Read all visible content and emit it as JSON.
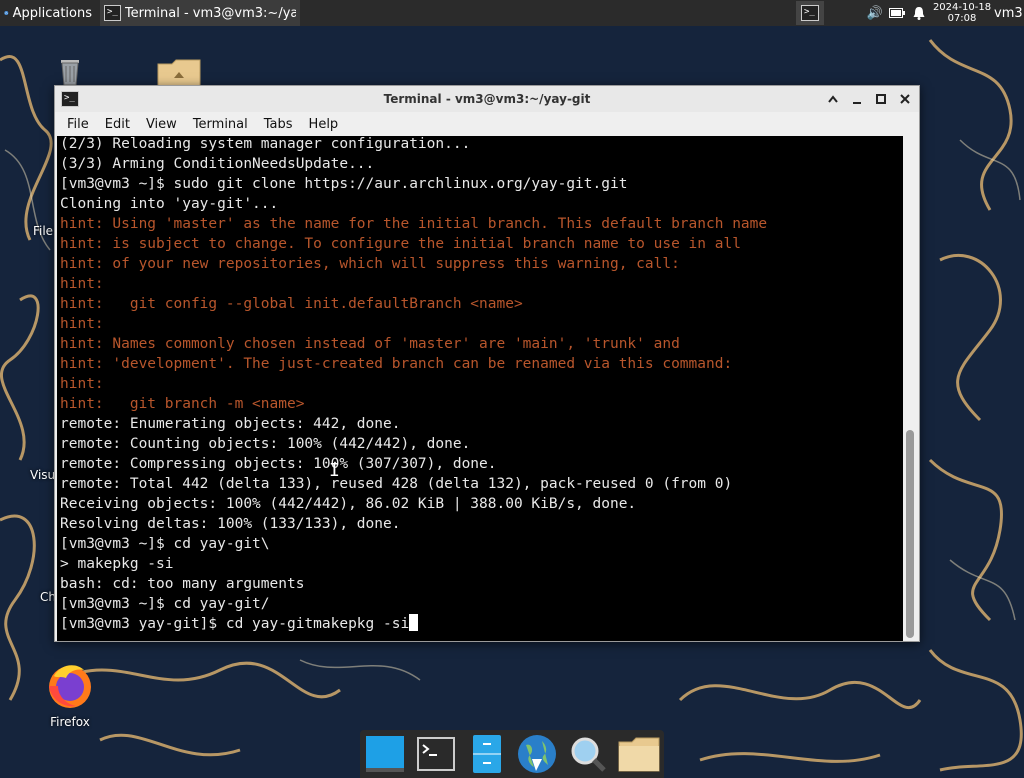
{
  "top_panel": {
    "applications_label": "Applications",
    "active_task_label": "Terminal - vm3@vm3:~/ya...",
    "clock_date": "2024-10-18",
    "clock_time": "07:08",
    "user": "vm3"
  },
  "desktop": {
    "icons": [
      {
        "name": "trash",
        "label": ""
      },
      {
        "name": "home-folder",
        "label": ""
      },
      {
        "name": "file-system",
        "label": "File"
      },
      {
        "name": "visual",
        "label": "Visu"
      },
      {
        "name": "chrome",
        "label": "Ch"
      },
      {
        "name": "firefox",
        "label": "Firefox"
      }
    ]
  },
  "window": {
    "title": "Terminal - vm3@vm3:~/yay-git",
    "menu": [
      "File",
      "Edit",
      "View",
      "Terminal",
      "Tabs",
      "Help"
    ],
    "controls": [
      "minimize-up",
      "minimize",
      "maximize",
      "close"
    ]
  },
  "terminal": {
    "lines": [
      {
        "text": "(2/3) Reloading system manager configuration...",
        "hint": false
      },
      {
        "text": "(3/3) Arming ConditionNeedsUpdate...",
        "hint": false
      },
      {
        "text": "[vm3@vm3 ~]$ sudo git clone https://aur.archlinux.org/yay-git.git",
        "hint": false
      },
      {
        "text": "Cloning into 'yay-git'...",
        "hint": false
      },
      {
        "text": "hint: Using 'master' as the name for the initial branch. This default branch name",
        "hint": true
      },
      {
        "text": "hint: is subject to change. To configure the initial branch name to use in all",
        "hint": true
      },
      {
        "text": "hint: of your new repositories, which will suppress this warning, call:",
        "hint": true
      },
      {
        "text": "hint:",
        "hint": true
      },
      {
        "text": "hint:   git config --global init.defaultBranch <name>",
        "hint": true
      },
      {
        "text": "hint:",
        "hint": true
      },
      {
        "text": "hint: Names commonly chosen instead of 'master' are 'main', 'trunk' and",
        "hint": true
      },
      {
        "text": "hint: 'development'. The just-created branch can be renamed via this command:",
        "hint": true
      },
      {
        "text": "hint:",
        "hint": true
      },
      {
        "text": "hint:   git branch -m <name>",
        "hint": true
      },
      {
        "text": "remote: Enumerating objects: 442, done.",
        "hint": false
      },
      {
        "text": "remote: Counting objects: 100% (442/442), done.",
        "hint": false
      },
      {
        "text": "remote: Compressing objects: 100% (307/307), done.",
        "hint": false
      },
      {
        "text": "remote: Total 442 (delta 133), reused 428 (delta 132), pack-reused 0 (from 0)",
        "hint": false
      },
      {
        "text": "Receiving objects: 100% (442/442), 86.02 KiB | 388.00 KiB/s, done.",
        "hint": false
      },
      {
        "text": "Resolving deltas: 100% (133/133), done.",
        "hint": false
      },
      {
        "text": "[vm3@vm3 ~]$ cd yay-git\\",
        "hint": false
      },
      {
        "text": "> makepkg -si",
        "hint": false
      },
      {
        "text": "bash: cd: too many arguments",
        "hint": false
      },
      {
        "text": "[vm3@vm3 ~]$ cd yay-git/",
        "hint": false
      },
      {
        "text": "[vm3@vm3 yay-git]$ cd yay-gitmakepkg -si",
        "hint": false,
        "cursor": true
      }
    ],
    "hint_color": "#b8562c",
    "text_color": "#e8e8e8",
    "background": "#000000"
  },
  "dock": {
    "items": [
      "show-desktop",
      "terminal",
      "file-manager",
      "web-browser",
      "search",
      "files-folder"
    ]
  }
}
